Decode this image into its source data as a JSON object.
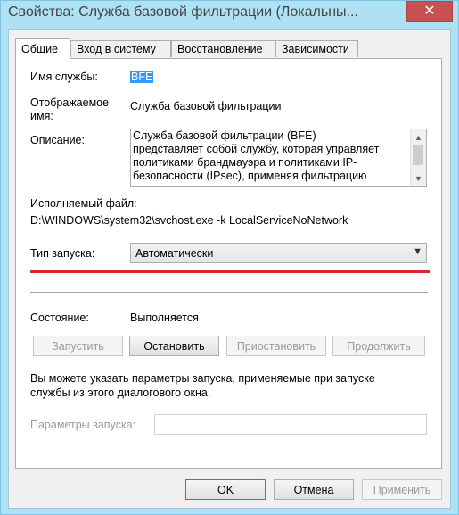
{
  "window": {
    "title": "Свойства: Служба базовой фильтрации (Локальны...",
    "close_glyph": "✕"
  },
  "tabs": [
    {
      "label": "Общие",
      "active": true
    },
    {
      "label": "Вход в систему",
      "active": false
    },
    {
      "label": "Восстановление",
      "active": false
    },
    {
      "label": "Зависимости",
      "active": false
    }
  ],
  "general": {
    "service_name_label": "Имя службы:",
    "service_name_value": "BFE",
    "display_name_label_line1": "Отображаемое",
    "display_name_label_line2": "имя:",
    "display_name_value": "Служба базовой фильтрации",
    "description_label": "Описание:",
    "description_lines": [
      "Служба базовой фильтрации (BFE)",
      "представляет собой службу, которая управляет",
      "политиками брандмауэра и политиками IP-",
      "безопасности (IPsec), применяя фильтрацию"
    ],
    "executable_label": "Исполняемый файл:",
    "executable_value": "D:\\WINDOWS\\system32\\svchost.exe -k LocalServiceNoNetwork",
    "startup_type_label": "Тип запуска:",
    "startup_type_value": "Автоматически",
    "status_label": "Состояние:",
    "status_value": "Выполняется",
    "buttons": {
      "start": "Запустить",
      "stop": "Остановить",
      "pause": "Приостановить",
      "resume": "Продолжить"
    },
    "hint_line1": "Вы можете указать параметры запуска, применяемые при запуске",
    "hint_line2": "службы из этого диалогового окна.",
    "params_label": "Параметры запуска:",
    "params_value": ""
  },
  "footer": {
    "ok": "OK",
    "cancel": "Отмена",
    "apply": "Применить"
  },
  "colors": {
    "title_bar": "#aee1f4",
    "close_button": "#c75050",
    "selection": "#3399ff",
    "highlight_line": "#d9232e"
  },
  "icons": {
    "close": "close-icon",
    "scroll_up": "scroll-up-arrow-icon",
    "scroll_down": "scroll-down-arrow-icon",
    "combo_arrow": "chevron-down-icon"
  }
}
